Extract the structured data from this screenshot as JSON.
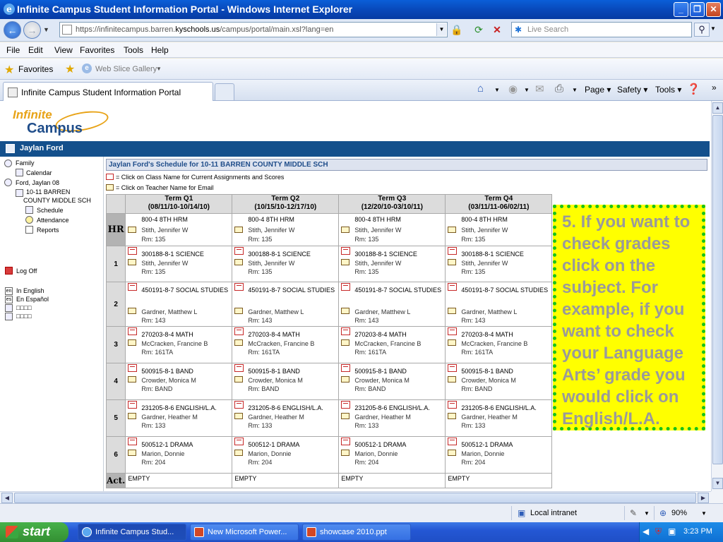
{
  "window": {
    "title": "Infinite Campus Student Information Portal - Windows Internet Explorer"
  },
  "address": {
    "url_pre": "https://infinitecampus.barren.",
    "url_host": "kyschools.us",
    "url_post": "/campus/portal/main.xsl?lang=en",
    "search_placeholder": "Live Search"
  },
  "menu": [
    "File",
    "Edit",
    "View",
    "Favorites",
    "Tools",
    "Help"
  ],
  "favorites_bar": {
    "favorites": "Favorites",
    "web_slice": "Web Slice Gallery"
  },
  "tab": {
    "label": "Infinite Campus Student Information Portal"
  },
  "command_bar": {
    "page": "Page",
    "safety": "Safety",
    "tools": "Tools"
  },
  "portal": {
    "logo_line1": "Infinite",
    "logo_line2": "Campus",
    "user_name": "Jaylan Ford",
    "sidebar": {
      "family": "Family",
      "calendar": "Calendar",
      "student": "Ford, Jaylan 08",
      "school_line1": "10-11 BARREN",
      "school_line2": "COUNTY MIDDLE SCH",
      "schedule": "Schedule",
      "attendance": "Attendance",
      "reports": "Reports",
      "logoff": "Log Off",
      "lang_en_code": "en",
      "lang_en": "In English",
      "lang_es_code": "es",
      "lang_es": "En Español",
      "lang_other1": "□□□□",
      "lang_other2": "□□□□"
    },
    "schedule_title": "Jaylan Ford's Schedule for 10-11 BARREN COUNTY MIDDLE SCH",
    "legend_class": "= Click on Class Name for Current Assignments and Scores",
    "legend_teacher": "= Click on Teacher Name for Email",
    "terms": [
      {
        "name": "Term Q1",
        "dates": "(08/11/10-10/14/10)"
      },
      {
        "name": "Term Q2",
        "dates": "(10/15/10-12/17/10)"
      },
      {
        "name": "Term Q3",
        "dates": "(12/20/10-03/10/11)"
      },
      {
        "name": "Term Q4",
        "dates": "(03/11/11-06/02/11)"
      }
    ],
    "rows": [
      {
        "period": "HR",
        "course": "800-4 8TH HRM",
        "teacher": "Stith, Jennifer W",
        "room": "Rm: 135"
      },
      {
        "period": "1",
        "course": "300188-8-1 SCIENCE",
        "teacher": "Stith, Jennifer W",
        "room": "Rm: 135"
      },
      {
        "period": "2",
        "course": "450191-8-7 SOCIAL STUDIES",
        "teacher": "Gardner, Matthew L",
        "room": "Rm: 143"
      },
      {
        "period": "3",
        "course": "270203-8-4 MATH",
        "teacher": "McCracken, Francine B",
        "room": "Rm: 161TA"
      },
      {
        "period": "4",
        "course": "500915-8-1 BAND",
        "teacher": "Crowder, Monica M",
        "room": "Rm: BAND"
      },
      {
        "period": "5",
        "course": "231205-8-6 ENGLISH/L.A.",
        "teacher": "Gardner, Heather M",
        "room": "Rm: 133"
      },
      {
        "period": "6",
        "course": "500512-1 DRAMA",
        "teacher": "Marion, Donnie",
        "room": "Rm: 204"
      }
    ],
    "hr_q4_course": "800-4 8TH HRM",
    "activity": {
      "period": "Act.",
      "value": "EMPTY"
    }
  },
  "callout": "5. If you want to check grades click on the subject. For example, if you want to check your Language Arts’ grade you would click on English/L.A.",
  "status": {
    "zone": "Local intranet",
    "zoom": "90%"
  },
  "taskbar": {
    "start": "start",
    "tasks": [
      "Infinite Campus Stud...",
      "New Microsoft Power...",
      "showcase 2010.ppt"
    ],
    "clock": "3:23 PM"
  }
}
